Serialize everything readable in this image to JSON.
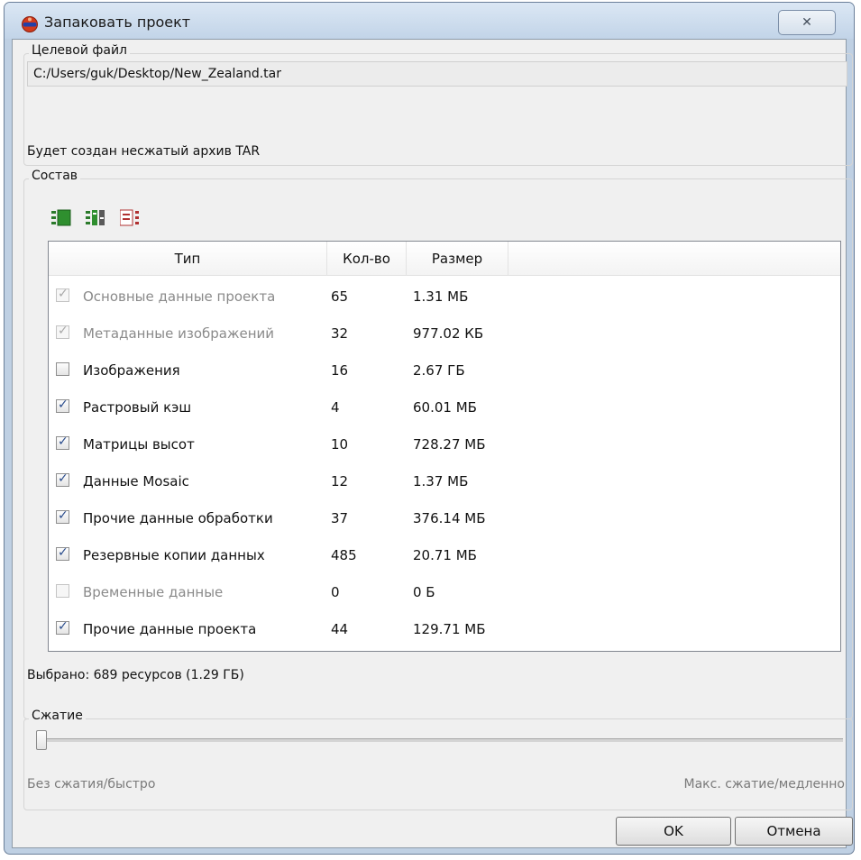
{
  "window": {
    "title": "Запаковать проект",
    "close_glyph": "✕"
  },
  "target": {
    "group_title": "Целевой файл",
    "path_value": "C:/Users/guk/Desktop/New_Zealand.tar",
    "archive_note": "Будет создан несжатый архив TAR"
  },
  "contents": {
    "group_title": "Состав",
    "toolbar_icons": [
      "select-all-icon",
      "invert-selection-icon",
      "deselect-all-icon"
    ],
    "columns": [
      "Тип",
      "Кол-во",
      "Размер"
    ],
    "rows": [
      {
        "checked": true,
        "enabled": false,
        "type": "Основные данные проекта",
        "count": "65",
        "size": "1.31 МБ"
      },
      {
        "checked": true,
        "enabled": false,
        "type": "Метаданные изображений",
        "count": "32",
        "size": "977.02 КБ"
      },
      {
        "checked": false,
        "enabled": true,
        "type": "Изображения",
        "count": "16",
        "size": "2.67 ГБ"
      },
      {
        "checked": true,
        "enabled": true,
        "type": "Растровый кэш",
        "count": "4",
        "size": "60.01 МБ"
      },
      {
        "checked": true,
        "enabled": true,
        "type": "Матрицы высот",
        "count": "10",
        "size": "728.27 МБ"
      },
      {
        "checked": true,
        "enabled": true,
        "type": "Данные Mosaic",
        "count": "12",
        "size": "1.37 МБ"
      },
      {
        "checked": true,
        "enabled": true,
        "type": "Прочие данные обработки",
        "count": "37",
        "size": "376.14 МБ"
      },
      {
        "checked": true,
        "enabled": true,
        "type": "Резервные копии данных",
        "count": "485",
        "size": "20.71 МБ"
      },
      {
        "checked": false,
        "enabled": false,
        "type": "Временные данные",
        "count": "0",
        "size": "0 Б"
      },
      {
        "checked": true,
        "enabled": true,
        "type": "Прочие данные проекта",
        "count": "44",
        "size": "129.71 МБ"
      }
    ],
    "summary": "Выбрано: 689 ресурсов (1.29 ГБ)"
  },
  "compression": {
    "group_title": "Сжатие",
    "level": 0,
    "min_label": "Без сжатия/быстро",
    "max_label": "Макс. сжатие/медленно"
  },
  "buttons": {
    "ok": "OK",
    "cancel": "Отмена"
  },
  "colors": {
    "accent": "#2a4c8c",
    "frame": "#bfd0e3"
  }
}
